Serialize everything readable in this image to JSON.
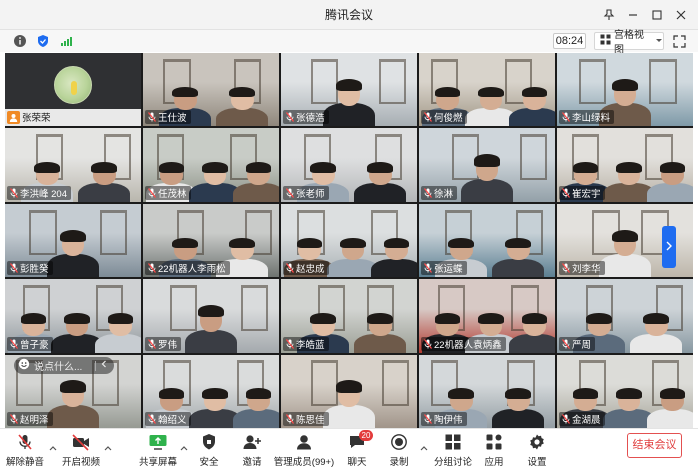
{
  "window": {
    "title": "腾讯会议",
    "controls": [
      "pin-icon",
      "minimize-icon",
      "maximize-icon",
      "close-icon"
    ]
  },
  "infobar": {
    "icons": [
      "info-icon",
      "shield-icon",
      "signal-icon"
    ],
    "timer": "08:24",
    "view_label": "宫格视图"
  },
  "participants": [
    {
      "name": "张荣荣",
      "host": true
    },
    {
      "name": "王仕波"
    },
    {
      "name": "张德浩"
    },
    {
      "name": "何俊燃"
    },
    {
      "name": "李山绿料"
    },
    {
      "name": "李洪峰 204"
    },
    {
      "name": "任茂林"
    },
    {
      "name": "张老师"
    },
    {
      "name": "徐淋"
    },
    {
      "name": "崔宏宇"
    },
    {
      "name": "彭胜癸"
    },
    {
      "name": "22机器人李雨松"
    },
    {
      "name": "赵忠成"
    },
    {
      "name": "张运蝶"
    },
    {
      "name": "刘李华"
    },
    {
      "name": "曾子豪"
    },
    {
      "name": "罗伟"
    },
    {
      "name": "李皓蓝"
    },
    {
      "name": "22机器人袁炳鑫"
    },
    {
      "name": "严周"
    },
    {
      "name": "赵明泽"
    },
    {
      "name": "翰绍义"
    },
    {
      "name": "陈思佳"
    },
    {
      "name": "陶伊伟"
    },
    {
      "name": "金湖晨"
    }
  ],
  "chat": {
    "placeholder": "说点什么..."
  },
  "toolbar": {
    "mute": "解除静音",
    "video": "开启视频",
    "share": "共享屏幕",
    "security": "安全",
    "invite": "邀请",
    "members": "管理成员(99+)",
    "chat": "聊天",
    "chat_badge": "20",
    "record": "录制",
    "breakout": "分组讨论",
    "apps": "应用",
    "settings": "设置",
    "end": "结束会议"
  },
  "colors": {
    "host_badge": "#f08a25",
    "end_button": "#e03c3c",
    "badge": "#e33b3b",
    "accent_blue": "#1e6cf0"
  }
}
